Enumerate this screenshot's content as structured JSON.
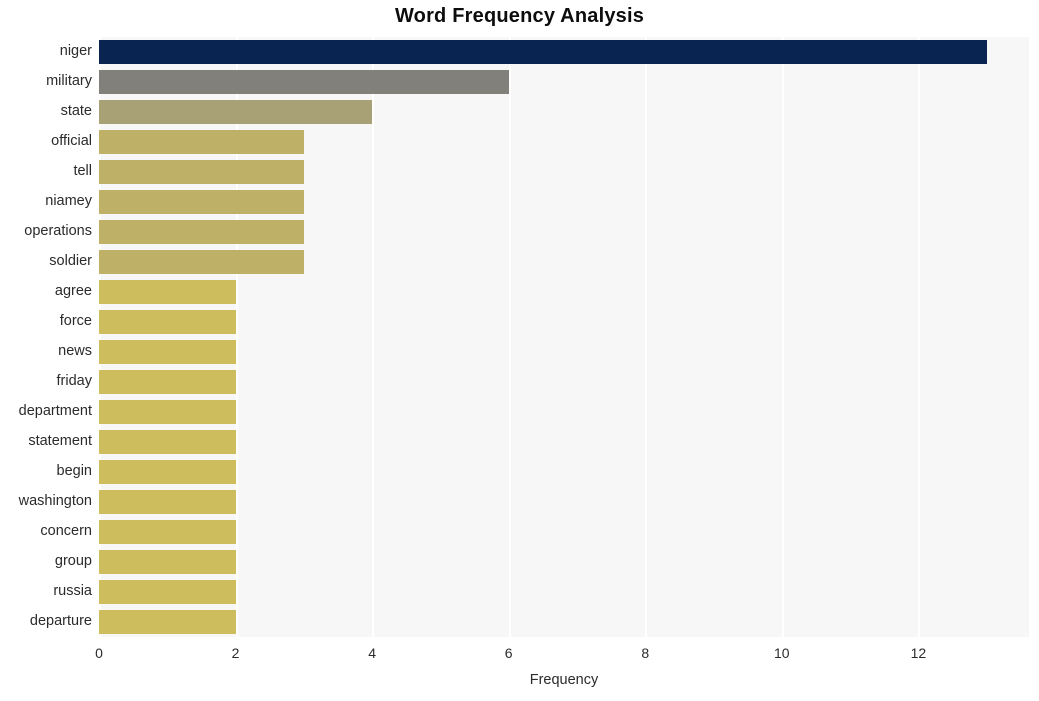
{
  "chart_data": {
    "type": "bar",
    "orientation": "horizontal",
    "title": "Word Frequency Analysis",
    "xlabel": "Frequency",
    "ylabel": "",
    "categories": [
      "niger",
      "military",
      "state",
      "official",
      "tell",
      "niamey",
      "operations",
      "soldier",
      "agree",
      "force",
      "news",
      "friday",
      "department",
      "statement",
      "begin",
      "washington",
      "concern",
      "group",
      "russia",
      "departure"
    ],
    "values": [
      13,
      6,
      4,
      3,
      3,
      3,
      3,
      3,
      2,
      2,
      2,
      2,
      2,
      2,
      2,
      2,
      2,
      2,
      2,
      2
    ],
    "bar_colors": [
      "#0a2452",
      "#82807a",
      "#a9a176",
      "#bfb068",
      "#bfb068",
      "#bfb068",
      "#bfb068",
      "#bfb068",
      "#cdbd5d",
      "#cdbd5d",
      "#cdbd5d",
      "#cdbd5d",
      "#cdbd5d",
      "#cdbd5d",
      "#cdbd5d",
      "#cdbd5d",
      "#cdbd5d",
      "#cdbd5d",
      "#cdbd5d",
      "#cdbd5d"
    ],
    "xticks": [
      0,
      2,
      4,
      6,
      8,
      10,
      12
    ],
    "xtick_labels": [
      "0",
      "2",
      "4",
      "6",
      "8",
      "10",
      "12"
    ],
    "xlim": [
      0,
      13.62
    ],
    "grid": true,
    "grid_axis": "x",
    "legend": false,
    "plot_background": "#f7f7f7",
    "gridline_color": "#ffffff",
    "figure_background": "#ffffff",
    "title_color": "#0d0d0d",
    "tick_label_color": "#2b2b2b"
  }
}
